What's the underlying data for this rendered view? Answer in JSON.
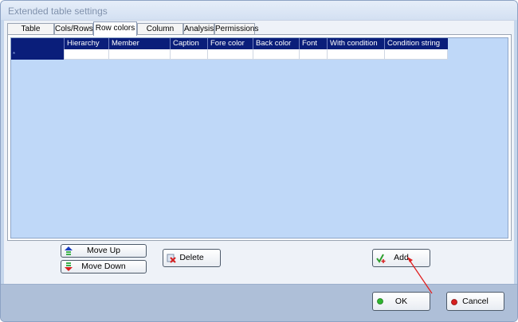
{
  "window": {
    "title": "Extended table settings"
  },
  "tabs": [
    {
      "label": "Table formats"
    },
    {
      "label": "Cols/Rows"
    },
    {
      "label": "Row colors"
    },
    {
      "label": "Column colors"
    },
    {
      "label": "Analysis"
    },
    {
      "label": "Permissions"
    }
  ],
  "active_tab": "Row colors",
  "grid": {
    "columns": [
      "Hierarchy",
      "Member",
      "Caption",
      "Fore color",
      "Back color",
      "Font",
      "With condition",
      "Condition string"
    ],
    "row_marker": "*"
  },
  "buttons": {
    "move_up": "Move Up",
    "move_down": "Move Down",
    "delete": "Delete",
    "add": "Add",
    "ok": "OK",
    "cancel": "Cancel"
  },
  "colors": {
    "header_bg": "#0a1e7a",
    "grid_bg": "#bfd8f8",
    "ok_dot": "#2fb52f",
    "cancel_dot": "#d62020",
    "pointer_arrow": "#e02020"
  }
}
